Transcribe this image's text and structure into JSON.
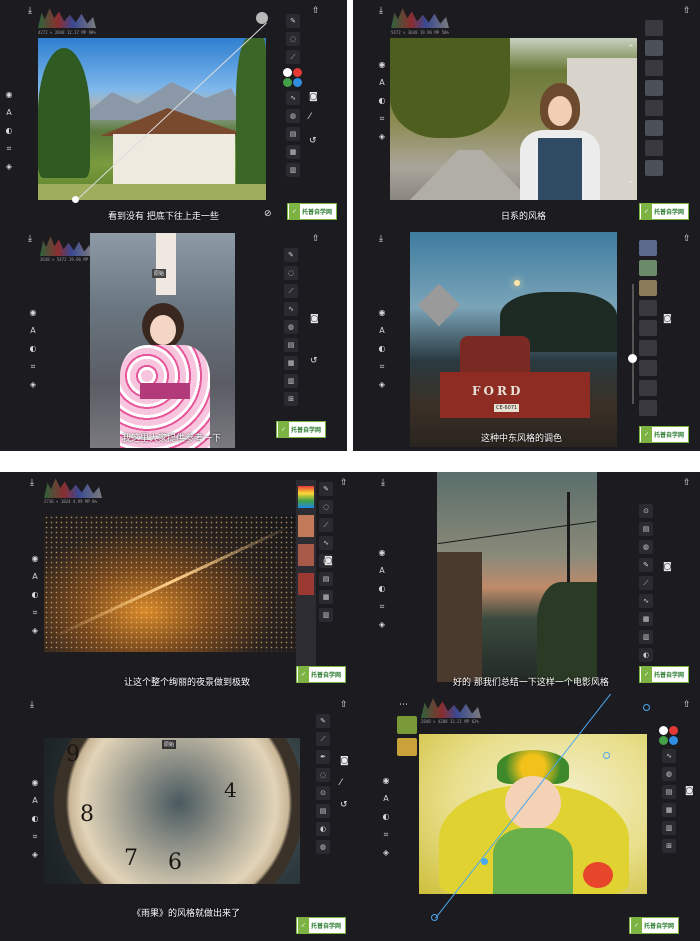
{
  "panels": [
    {
      "caption": "看到没有 把底下往上走一些",
      "meta": "4272 × 2848   12.17 MP   98%",
      "meta2": "1/500 sec   f/8   ISO 100"
    },
    {
      "caption": "日系的风格",
      "meta": "5472 × 3648   19.96 MP   50%"
    },
    {
      "caption": "我这里大家提供参考一下",
      "meta": "3648 × 5472   19.96 MP   19%",
      "badge": "原始"
    },
    {
      "caption": "这种中东风格的调色",
      "sign_top": "FORD",
      "plate": "CE-6071"
    },
    {
      "caption": "让这个整个绚丽的夜景做到极致",
      "meta": "2736 × 1824   4.99 MP   8%"
    },
    {
      "caption": "好的 那我们总结一下这样一个电影风格"
    },
    {
      "caption": "《雨果》的风格就做出来了",
      "badge": "原始"
    },
    {
      "caption": "",
      "meta": "2848 × 4288   12.21 MP   62%"
    }
  ],
  "logo_text": "托普自学网",
  "logo_sub": "www.tuopu.com",
  "icons": {
    "download": "download-icon",
    "share": "share-icon",
    "undo": "undo-icon",
    "redo": "redo-icon",
    "crop": "crop-icon",
    "layers": "layers-icon",
    "eye": "eye-icon"
  },
  "colors": {
    "panel_bg": "#1c1b20",
    "accent_blue": "#2f8ee0",
    "red": "#e53935",
    "green": "#43a047"
  }
}
